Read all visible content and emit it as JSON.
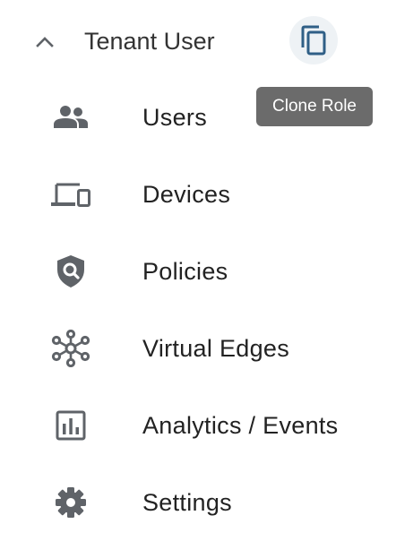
{
  "header": {
    "role_name": "Tenant User",
    "collapse_icon": "chevron-up-icon",
    "clone_icon": "copy-icon",
    "clone_tooltip": "Clone Role"
  },
  "menu": {
    "items": [
      {
        "label": "Users",
        "icon": "users-icon"
      },
      {
        "label": "Devices",
        "icon": "devices-icon"
      },
      {
        "label": "Policies",
        "icon": "policies-shield-icon"
      },
      {
        "label": "Virtual Edges",
        "icon": "network-hub-icon"
      },
      {
        "label": "Analytics / Events",
        "icon": "analytics-chart-icon"
      },
      {
        "label": "Settings",
        "icon": "gear-icon"
      }
    ]
  },
  "colors": {
    "icon": "#5f6368",
    "clone_icon": "#2f5f86",
    "clone_button_bg": "#eef2f5",
    "tooltip_bg": "#6b6b6b"
  }
}
